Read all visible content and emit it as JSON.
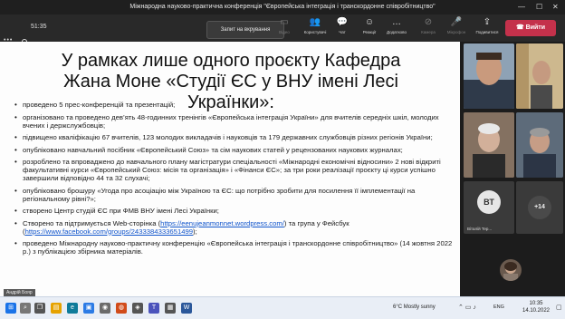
{
  "window": {
    "title": "Міжнародна науково-практична конференція \"Європейська інтеграція і транскордонне співробітництво\""
  },
  "toolbar": {
    "timer": "51:35",
    "record_label": "Запит на вкрування",
    "items": [
      {
        "label": "Відео"
      },
      {
        "label": "Користувачі"
      },
      {
        "label": "Чат"
      },
      {
        "label": "Реакції"
      },
      {
        "label": "Додатково"
      },
      {
        "label": "Камера"
      },
      {
        "label": "Мікрофон"
      },
      {
        "label": "Подивитися"
      }
    ],
    "leave_label": "Вийти"
  },
  "slide": {
    "title": "У рамках лише одного проєкту Кафедра Жана Моне «Студії ЄС у ВНУ імені Лесі Українки»:",
    "bullets": [
      "проведено 5 прес-конференцій та презентацій;",
      "організовано та проведено дев’ять 48-годинних тренінгів «Європейська інтеграція України» для вчителів середніх шкіл, молодих вчених і держслужбовців;",
      "підвищено кваліфікацію 67 вчителів, 123 молодих викладачів і науковців та 179 державних службовців різних регіонів України;",
      "опубліковано навчальний посібник «Європейський Союз» та сім наукових статей у рецензованих наукових журналах;",
      "розроблено та впроваджено до навчального плану магістратури спеціальності «Міжнародні економічні відносини» 2 нові відкриті факультативні курси «Європейський Союз: місія та організація» і «Фінанси ЄС»; за три роки реалізації проєкту ці курси успішно завершили відповідно 44 та 32 слухачі;",
      "опубліковано брошуру «Угода про асоціацію між Україною та ЄС: що потрібно зробити для посилення її імплементації на регіональному рівні?»;",
      "створено Центр студій ЄС при ФМВ ВНУ імені Лесі Українки;"
    ],
    "web_bullet": {
      "prefix": "Створено та підтримується Web-сторінка (",
      "link1": "https://eenujeanmonnet.wordpress.com/",
      "middle": ") та група у Фейсбук (",
      "link2": "https://www.facebook.com/groups/2433384333651499",
      "suffix": ");"
    },
    "last_bullet": "проведено Міжнародну науково-практичну конференцію «Європейська інтеграція і транскордонне співробітництво» (14 жовтня 2022 р.) з публікацією збірника матеріалів.",
    "presenter": "Андрій Бояр"
  },
  "participants": {
    "initials": "ВТ",
    "name": "Віталій Тер...",
    "more": "+14"
  },
  "taskbar": {
    "weather": "6°C  Mostly sunny",
    "lang": "ENG",
    "time": "10:35",
    "date": "14.10.2022"
  },
  "colors": {
    "leave": "#c4314b",
    "link": "#1155cc",
    "slide_bg": "#fdfdfd"
  }
}
